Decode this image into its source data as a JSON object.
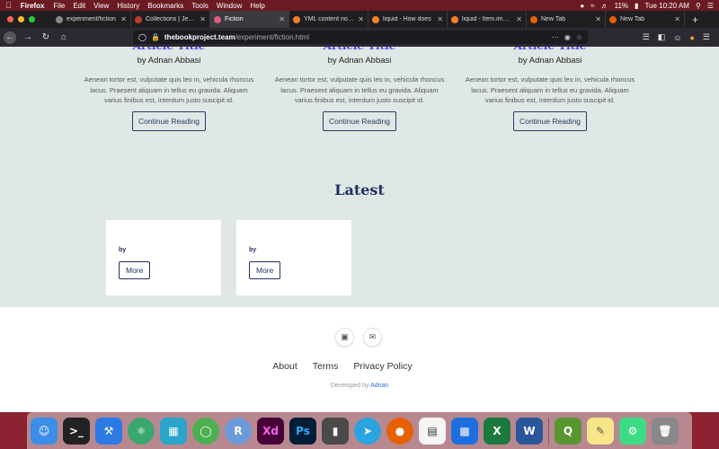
{
  "menubar": {
    "app": "Firefox",
    "items": [
      "File",
      "Edit",
      "View",
      "History",
      "Bookmarks",
      "Tools",
      "Window",
      "Help"
    ],
    "battery": "11%",
    "clock": "Tue 10:20 AM"
  },
  "tabs": [
    {
      "label": "experiment/fiction",
      "active": false
    },
    {
      "label": "Collections | Jekyll",
      "active": false
    },
    {
      "label": "Fiction",
      "active": true
    },
    {
      "label": "YML content not d",
      "active": false
    },
    {
      "label": "liquid - How does",
      "active": false
    },
    {
      "label": "liquid - Item.image",
      "active": false
    },
    {
      "label": "New Tab",
      "active": false
    },
    {
      "label": "New Tab",
      "active": false
    }
  ],
  "address": {
    "host": "thebookproject.team",
    "path": "/experiment/fiction.html"
  },
  "articles": [
    {
      "title": "Article Title",
      "byline": "by Adnan Abbasi",
      "excerpt": "Aenean tortor est, vulputate quis leo in, vehicula rhoncus lacus. Praesent aliquam in tellus eu gravida. Aliquam varius finibus est, interdum justo suscipit id.",
      "button": "Continue Reading"
    },
    {
      "title": "Article Title",
      "byline": "by Adnan Abbasi",
      "excerpt": "Aenean tortor est, vulputate quis leo in, vehicula rhoncus lacus. Praesent aliquam in tellus eu gravida. Aliquam varius finibus est, interdum justo suscipit id.",
      "button": "Continue Reading"
    },
    {
      "title": "Article Title",
      "byline": "by Adnan Abbasi",
      "excerpt": "Aenean tortor est, vulputate quis leo in, vehicula rhoncus lacus. Praesent aliquam in tellus eu gravida. Aliquam varius finibus est, interdum justo suscipit id.",
      "button": "Continue Reading"
    }
  ],
  "latest": {
    "title": "Latest",
    "cards": [
      {
        "by": "by",
        "button": "More"
      },
      {
        "by": "by",
        "button": "More"
      }
    ]
  },
  "footer": {
    "social_icons": [
      "instagram-icon",
      "mail-icon"
    ],
    "links": [
      "About",
      "Terms",
      "Privacy Policy"
    ],
    "developed_prefix": "Developed by",
    "developer": "Adnan"
  },
  "dock": {
    "icons": [
      "finder-icon",
      "terminal-icon",
      "xcode-icon",
      "atom-icon",
      "app-icon",
      "circle-app-icon",
      "r-icon",
      "xd-icon",
      "photoshop-icon",
      "sublime-icon",
      "telegram-icon",
      "firefox-icon",
      "calendar-icon",
      "keynote-icon",
      "excel-icon",
      "word-icon",
      "qgis-icon",
      "notes-icon",
      "android-studio-icon",
      "trash-icon"
    ],
    "r_label": "R",
    "xd_label": "Xd",
    "ps_label": "Ps"
  },
  "colors": {
    "accent_title": "#5b3ee6",
    "navy": "#243060",
    "content_bg": "#dfe8e6"
  }
}
